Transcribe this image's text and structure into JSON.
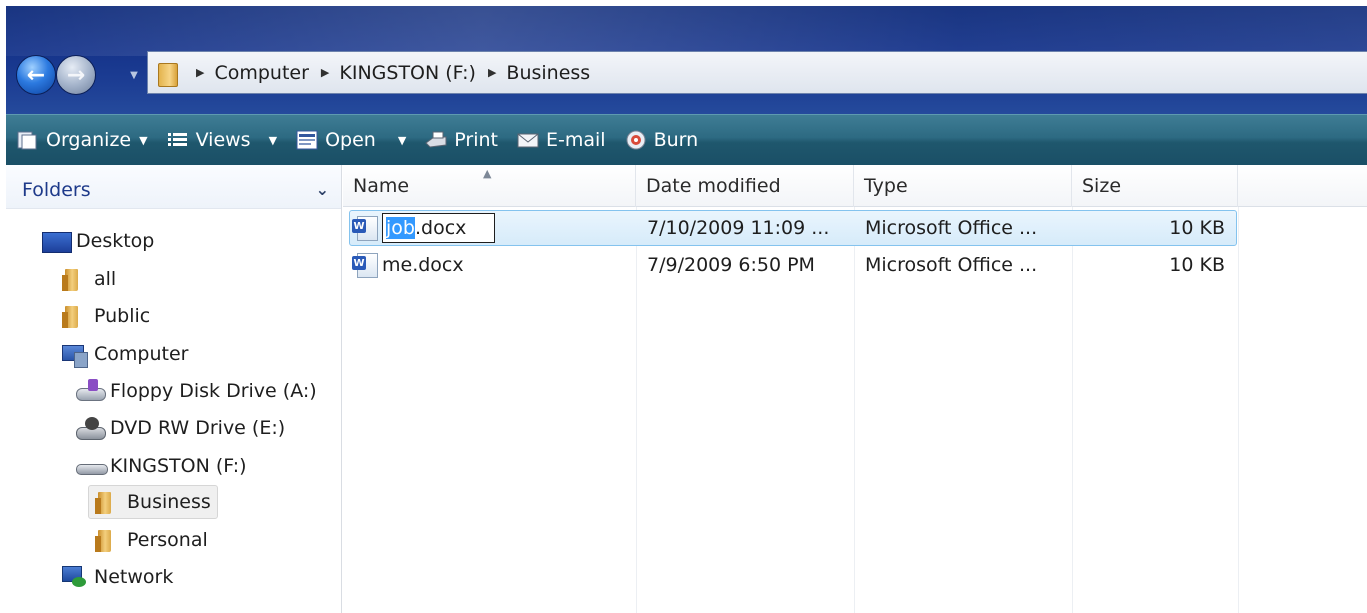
{
  "breadcrumb": [
    "Computer",
    "KINGSTON (F:)",
    "Business"
  ],
  "toolbar": {
    "organize": "Organize",
    "views": "Views",
    "open": "Open",
    "print": "Print",
    "email": "E-mail",
    "burn": "Burn"
  },
  "sidebar": {
    "header": "Folders",
    "items": [
      {
        "label": "Desktop",
        "icon": "desktop-icon"
      },
      {
        "label": "all",
        "icon": "user-folder-icon"
      },
      {
        "label": "Public",
        "icon": "folder-icon"
      },
      {
        "label": "Computer",
        "icon": "computer-icon"
      },
      {
        "label": "Floppy Disk Drive (A:)",
        "icon": "floppy-drive-icon"
      },
      {
        "label": "DVD RW Drive (E:)",
        "icon": "dvd-drive-icon"
      },
      {
        "label": "KINGSTON (F:)",
        "icon": "usb-drive-icon"
      },
      {
        "label": "Business",
        "icon": "folder-icon",
        "selected": true
      },
      {
        "label": "Personal",
        "icon": "folder-icon"
      },
      {
        "label": "Network",
        "icon": "network-icon"
      }
    ]
  },
  "columns": {
    "name": "Name",
    "date": "Date modified",
    "type": "Type",
    "size": "Size"
  },
  "files": [
    {
      "name": "job.docx",
      "rename_selected": "job",
      "rename_rest": ".docx",
      "date": "7/10/2009 11:09 ...",
      "type": "Microsoft Office ...",
      "size": "10 KB",
      "selected": true,
      "renaming": true
    },
    {
      "name": "me.docx",
      "date": "7/9/2009 6:50 PM",
      "type": "Microsoft Office ...",
      "size": "10 KB"
    }
  ],
  "colors": {
    "titlebar": "#15338a",
    "toolbar": "#2d6a82",
    "selection": "#d6ebfa",
    "rename_highlight": "#3399ff",
    "folders_header_text": "#1e3a8a"
  }
}
